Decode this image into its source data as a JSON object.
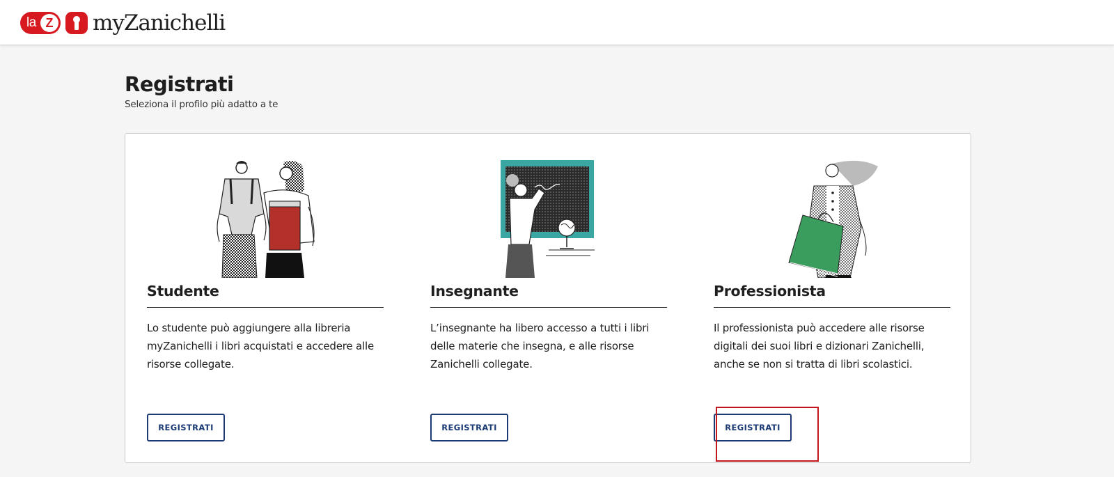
{
  "header": {
    "logo_la": "la",
    "logo_z": "Z",
    "brand": "myZanichelli"
  },
  "page": {
    "title": "Registrati",
    "subtitle": "Seleziona il profilo più adatto a te"
  },
  "profiles": [
    {
      "title": "Studente",
      "description": "Lo studente può aggiungere alla libreria myZanichelli i libri acquistati e accedere alle risorse collegate.",
      "button_label": "REGISTRATI",
      "illustration": "students-with-backpack-illustration"
    },
    {
      "title": "Insegnante",
      "description": "L’insegnante ha libero accesso a tutti i libri delle materie che insegna, e alle risorse Zanichelli collegate.",
      "button_label": "REGISTRATI",
      "illustration": "teacher-at-blackboard-illustration"
    },
    {
      "title": "Professionista",
      "description": "Il professionista può accedere alle risorse digitali dei suoi libri e dizionari Zanichelli, anche se non si tratta di libri scolastici.",
      "button_label": "REGISTRATI",
      "illustration": "professional-with-shopping-bag-illustration"
    }
  ],
  "colors": {
    "brand_red": "#d71920",
    "button_blue": "#1b3a73",
    "highlight_red": "#c4161c",
    "page_bg": "#f5f5f5"
  }
}
